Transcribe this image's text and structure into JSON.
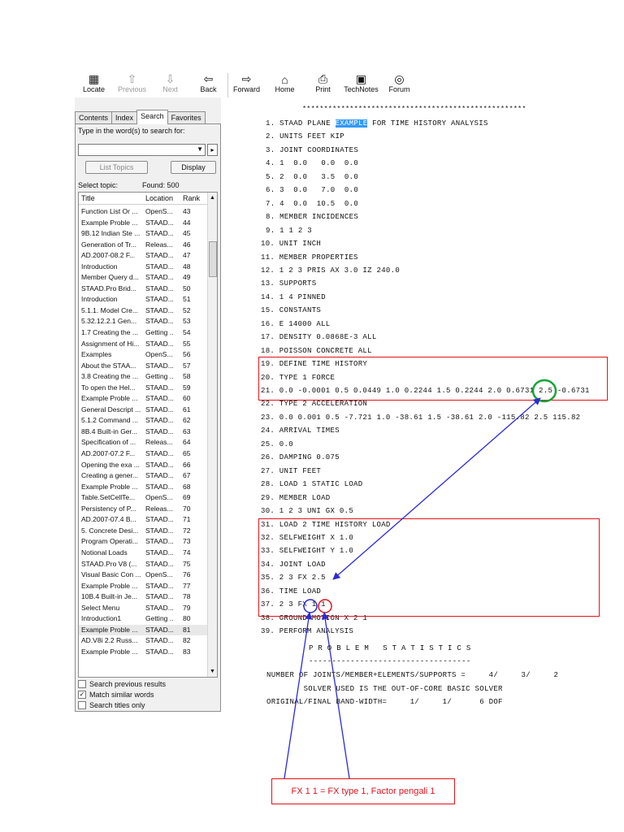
{
  "toolbar": {
    "buttons": [
      {
        "label": "Locate",
        "icon": "locate-icon",
        "enabled": true
      },
      {
        "label": "Previous",
        "icon": "arrow-up-icon",
        "enabled": false
      },
      {
        "label": "Next",
        "icon": "arrow-down-icon",
        "enabled": false
      },
      {
        "label": "Back",
        "icon": "arrow-left-icon",
        "enabled": true
      },
      {
        "label": "Forward",
        "icon": "arrow-right-icon",
        "enabled": true
      },
      {
        "label": "Home",
        "icon": "home-icon",
        "enabled": true
      },
      {
        "label": "Print",
        "icon": "printer-icon",
        "enabled": true
      },
      {
        "label": "TechNotes",
        "icon": "technotes-icon",
        "enabled": true
      },
      {
        "label": "Forum",
        "icon": "forum-icon",
        "enabled": true
      }
    ]
  },
  "tabs": [
    "Contents",
    "Index",
    "Search",
    "Favorites"
  ],
  "active_tab": "Search",
  "search": {
    "prompt": "Type in the word(s) to search for:",
    "value": "",
    "list_topics_label": "List Topics",
    "display_label": "Display",
    "select_topic_label": "Select topic:",
    "found_label": "Found: 500"
  },
  "results": {
    "columns": [
      "Title",
      "Location",
      "Rank"
    ],
    "rows": [
      [
        "Function List Or ...",
        "OpenS...",
        "43"
      ],
      [
        "Example Proble ...",
        "STAAD...",
        "44"
      ],
      [
        "9B.12 Indian Ste ...",
        "STAAD...",
        "45"
      ],
      [
        "Generation of Tr...",
        "Releas...",
        "46"
      ],
      [
        "AD.2007-08.2 F...",
        "STAAD...",
        "47"
      ],
      [
        "Introduction",
        "STAAD...",
        "48"
      ],
      [
        "Member Query d...",
        "STAAD...",
        "49"
      ],
      [
        "STAAD.Pro Brid...",
        "STAAD...",
        "50"
      ],
      [
        "Introduction",
        "STAAD...",
        "51"
      ],
      [
        "5.1.1. Model Cre...",
        "STAAD...",
        "52"
      ],
      [
        "5.32.12.2.1 Gen...",
        "STAAD...",
        "53"
      ],
      [
        "1.7 Creating the ...",
        "Getting ...",
        "54"
      ],
      [
        "Assignment of Hi...",
        "STAAD...",
        "55"
      ],
      [
        "Examples",
        "OpenS...",
        "56"
      ],
      [
        "About the STAA...",
        "STAAD...",
        "57"
      ],
      [
        "3.8 Creating the ...",
        "Getting ...",
        "58"
      ],
      [
        "To open the Hel...",
        "STAAD...",
        "59"
      ],
      [
        "Example Proble ...",
        "STAAD...",
        "60"
      ],
      [
        "General Descript ...",
        "STAAD...",
        "61"
      ],
      [
        "5.1.2 Command ...",
        "STAAD...",
        "62"
      ],
      [
        "8B.4 Built-in Ger...",
        "STAAD...",
        "63"
      ],
      [
        "Specification of ...",
        "Releas...",
        "64"
      ],
      [
        "AD.2007-07.2 F...",
        "STAAD...",
        "65"
      ],
      [
        "Opening the exa ...",
        "STAAD...",
        "66"
      ],
      [
        "Creating a gener...",
        "STAAD...",
        "67"
      ],
      [
        "Example Proble ...",
        "STAAD...",
        "68"
      ],
      [
        "Table.SetCellTe...",
        "OpenS...",
        "69"
      ],
      [
        "Persistency of P...",
        "Releas...",
        "70"
      ],
      [
        "AD.2007-07.4 B...",
        "STAAD...",
        "71"
      ],
      [
        "5. Concrete Desi...",
        "STAAD...",
        "72"
      ],
      [
        "Program Operati...",
        "STAAD...",
        "73"
      ],
      [
        "Notional Loads",
        "STAAD...",
        "74"
      ],
      [
        "STAAD.Pro V8 (...",
        "STAAD...",
        "75"
      ],
      [
        "Visual Basic Con ...",
        "OpenS...",
        "76"
      ],
      [
        "Example Proble ...",
        "STAAD...",
        "77"
      ],
      [
        "10B.4 Built-in Je...",
        "STAAD...",
        "78"
      ],
      [
        "Select Menu",
        "STAAD...",
        "79"
      ],
      [
        "Introduction1",
        "Getting ...",
        "80"
      ],
      [
        "Example Proble ...",
        "STAAD...",
        "81"
      ],
      [
        "AD.V8i 2.2 Russ...",
        "STAAD...",
        "82"
      ],
      [
        "Example Proble ...",
        "STAAD...",
        "83"
      ]
    ],
    "selected_index": 38
  },
  "options": [
    {
      "label": "Search previous results",
      "checked": false
    },
    {
      "label": "Match similar words",
      "checked": true
    },
    {
      "label": "Search titles only",
      "checked": false
    }
  ],
  "code": {
    "stars": "****************************************************",
    "line1_prefix": "1. STAAD PLANE ",
    "line1_highlight": "EXAMPLE",
    "line1_suffix": " FOR TIME HISTORY ANALYSIS",
    "lines": [
      "2. UNITS FEET KIP",
      "3. JOINT COORDINATES",
      "4. 1  0.0   0.0  0.0",
      "5. 2  0.0   3.5  0.0",
      "6. 3  0.0   7.0  0.0",
      "7. 4  0.0  10.5  0.0",
      "8. MEMBER INCIDENCES",
      "9. 1 1 2 3",
      "10. UNIT INCH",
      "11. MEMBER PROPERTIES",
      "12. 1 2 3 PRIS AX 3.0 IZ 240.0",
      "13. SUPPORTS",
      "14. 1 4 PINNED",
      "15. CONSTANTS",
      "16. E 14000 ALL",
      "17. DENSITY 0.0868E-3 ALL",
      "18. POISSON CONCRETE ALL",
      "19. DEFINE TIME HISTORY",
      "20. TYPE 1 FORCE",
      "21. 0.0 -0.0001 0.5 0.0449 1.0 0.2244 1.5 0.2244 2.0 0.6731 2.5 -0.6731",
      "22. TYPE 2 ACCELERATION",
      "23. 0.0 0.001 0.5 -7.721 1.0 -38.61 1.5 -38.61 2.0 -115.82 2.5 115.82",
      "24. ARRIVAL TIMES",
      "25. 0.0",
      "26. DAMPING 0.075",
      "27. UNIT FEET",
      "28. LOAD 1 STATIC LOAD",
      "29. MEMBER LOAD",
      "30. 1 2 3 UNI GX 0.5",
      "31. LOAD 2 TIME HISTORY LOAD",
      "32. SELFWEIGHT X 1.0",
      "33. SELFWEIGHT Y 1.0",
      "34. JOINT LOAD",
      "35. 2 3 FX 2.5",
      "36. TIME LOAD",
      "37. 2 3 FX 1 1",
      "38. GROUND MOTION X 2 1",
      "39. PERFORM ANALYSIS"
    ],
    "stats_title": "P R O B L E M   S T A T I S T I C S",
    "stats_rule": "-----------------------------------",
    "stats_lines": [
      "NUMBER OF JOINTS/MEMBER+ELEMENTS/SUPPORTS =     4/     3/     2",
      "        SOLVER USED IS THE OUT-OF-CORE BASIC SOLVER",
      "ORIGINAL/FINAL BAND-WIDTH=     1/     1/      6 DOF"
    ]
  },
  "annotation": {
    "note": "FX 1 1 = FX type 1, Factor pengali  1",
    "box_color": "#e0141e",
    "arrow_color": "#2b2bd6",
    "circle_green": "#1aa33a",
    "highlight_color": "#3399ff"
  }
}
